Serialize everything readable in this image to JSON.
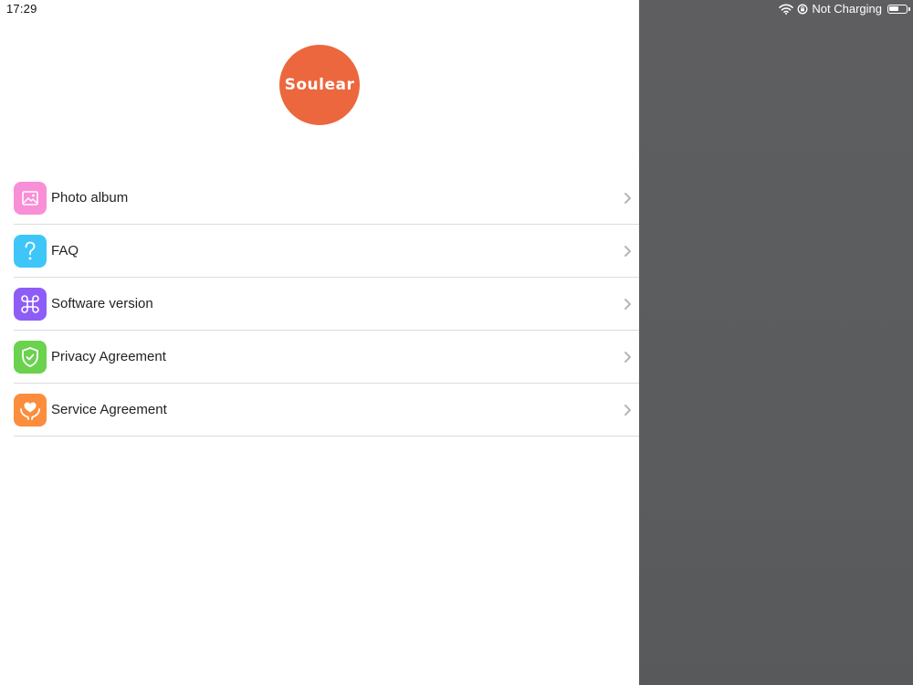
{
  "status_bar": {
    "time": "17:29",
    "charging_text": "Not Charging",
    "battery_level": 0.6
  },
  "logo": {
    "text": "Soulear",
    "color": "#ec673e"
  },
  "menu": {
    "items": [
      {
        "label": "Photo album",
        "icon": "photo-icon",
        "color": "#f88fd7"
      },
      {
        "label": "FAQ",
        "icon": "question-icon",
        "color": "#3ec6f9"
      },
      {
        "label": "Software version",
        "icon": "command-icon",
        "color": "#8e5cf7"
      },
      {
        "label": "Privacy Agreement",
        "icon": "shield-check-icon",
        "color": "#6ad24d"
      },
      {
        "label": "Service Agreement",
        "icon": "heart-hands-icon",
        "color": "#fb8d3c"
      }
    ]
  }
}
